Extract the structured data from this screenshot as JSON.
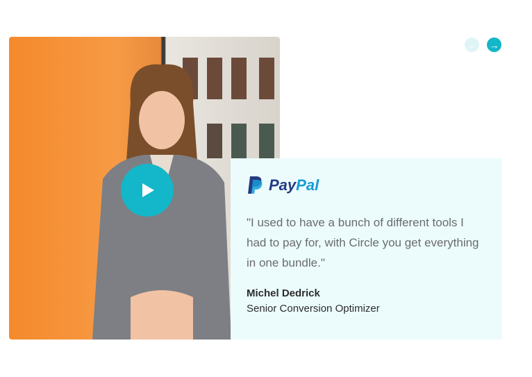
{
  "testimonial": {
    "company": {
      "name_part1": "Pay",
      "name_part2": "Pal",
      "icon": "paypal-logo-icon"
    },
    "quote": "\"I used to have a bunch of different tools I had to pay for, with Circle you get everything in one bundle.\"",
    "author_name": "Michel Dedrick",
    "author_role": "Senior Conversion Optimizer"
  },
  "controls": {
    "prev_icon": "arrow-left-icon",
    "next_icon": "arrow-right-icon",
    "play_icon": "play-icon"
  },
  "colors": {
    "accent": "#14b6c9",
    "accent_disabled": "#dff4f7",
    "card_bg": "#ecfcfd"
  }
}
